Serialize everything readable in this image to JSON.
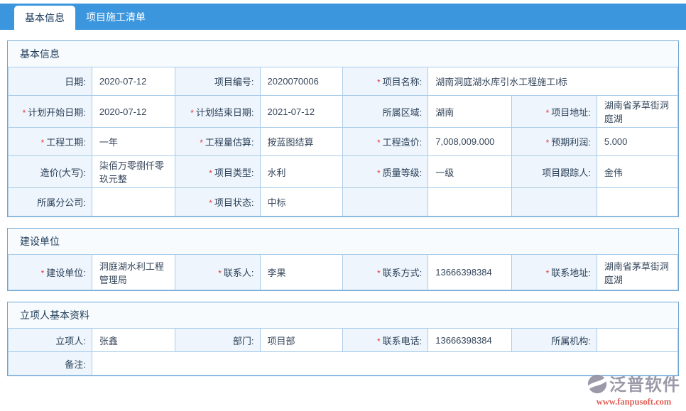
{
  "colors": {
    "accent_blue": "#3c96dd",
    "label_cell_bg": "#eef5fc",
    "cell_border": "#a9cdeb",
    "section_border": "#6ea6d4",
    "required_red": "#e03b3b",
    "watermark_gray": "#9795a5",
    "watermark_red": "#e1564c"
  },
  "tabs": [
    {
      "label": "基本信息",
      "active": true
    },
    {
      "label": "项目施工清单",
      "active": false
    }
  ],
  "sections": [
    {
      "title": "基本信息",
      "rows": [
        {
          "cells": [
            {
              "l": "日期:",
              "v": "2020-07-12"
            },
            {
              "l": "项目编号:",
              "v": "2020070006"
            },
            {
              "r": "*",
              "l": "项目名称:",
              "v": "湖南洞庭湖水库引水工程施工I标"
            }
          ]
        },
        {
          "cells": [
            {
              "r": "*",
              "l": "计划开始日期:",
              "v": "2020-07-12"
            },
            {
              "r": "*",
              "l": "计划结束日期:",
              "v": "2021-07-12"
            },
            {
              "l": "所属区域:",
              "v": "湖南"
            },
            {
              "r": "*",
              "l": "项目地址:",
              "v": "湖南省茅草街洞庭湖"
            }
          ]
        },
        {
          "cells": [
            {
              "r": "*",
              "l": "工程工期:",
              "v": "一年"
            },
            {
              "r": "*",
              "l": "工程量估算:",
              "v": "按蓝图结算"
            },
            {
              "r": "*",
              "l": "工程造价:",
              "v": "7,008,009.000"
            },
            {
              "r": "*",
              "l": "预期利润:",
              "v": "5.000"
            }
          ]
        },
        {
          "cells": [
            {
              "l": "造价(大写):",
              "v": "柒佰万零捌仟零玖元整"
            },
            {
              "r": "*",
              "l": "项目类型:",
              "v": "水利"
            },
            {
              "r": "*",
              "l": "质量等级:",
              "v": "一级"
            },
            {
              "l": "项目跟踪人:",
              "v": "金伟"
            }
          ]
        },
        {
          "cells": [
            {
              "l": "所属分公司:",
              "v": ""
            },
            {
              "r": "*",
              "l": "项目状态:",
              "v": "中标"
            },
            {
              "l": "",
              "v": ""
            },
            {
              "l": "",
              "v": ""
            }
          ]
        }
      ]
    },
    {
      "title": "建设单位",
      "rows": [
        {
          "cells": [
            {
              "r": "*",
              "l": "建设单位:",
              "v": "洞庭湖水利工程管理局"
            },
            {
              "r": "*",
              "l": "联系人:",
              "v": "李果"
            },
            {
              "r": "*",
              "l": "联系方式:",
              "v": "13666398384"
            },
            {
              "r": "*",
              "l": "联系地址:",
              "v": "湖南省茅草街洞庭湖"
            }
          ]
        }
      ]
    },
    {
      "title": "立项人基本资料",
      "rows": [
        {
          "cells": [
            {
              "l": "立项人:",
              "v": "张鑫"
            },
            {
              "l": "部门:",
              "v": "项目部"
            },
            {
              "r": "*",
              "l": "联系电话:",
              "v": "13666398384"
            },
            {
              "l": "所属机构:",
              "v": ""
            }
          ]
        },
        {
          "cells": [
            {
              "l": "备注:",
              "v": ""
            }
          ]
        }
      ]
    }
  ],
  "watermark": {
    "brand": "泛普软件",
    "url": "www.fanpusoft.com"
  }
}
